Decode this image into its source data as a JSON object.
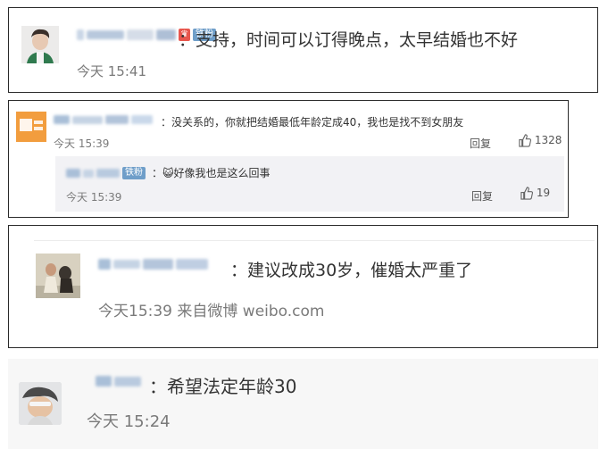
{
  "comments": [
    {
      "text": "：支持，时间可以订得晚点，太早结婚也不好",
      "time": "今天 15:41",
      "badge": "铁粉"
    },
    {
      "text": "：没关系的，你就把结婚最低年龄定成40，我也是找不到女朋友",
      "time": "今天 15:39",
      "reply_label": "回复",
      "likes": "1328",
      "reply": {
        "badge": "铁粉",
        "text": "：😺好像我也是这么回事",
        "time": "今天 15:39",
        "reply_label": "回复",
        "likes": "19"
      }
    },
    {
      "text": "：建议改成30岁，催婚太严重了",
      "time": "今天15:39 来自微博 weibo.com"
    },
    {
      "text": "：希望法定年龄30",
      "time": "今天 15:24"
    }
  ],
  "colors": {
    "fan_badge": "#6f9ec9",
    "time_text": "#7a7a7a",
    "body_text": "#333333"
  }
}
